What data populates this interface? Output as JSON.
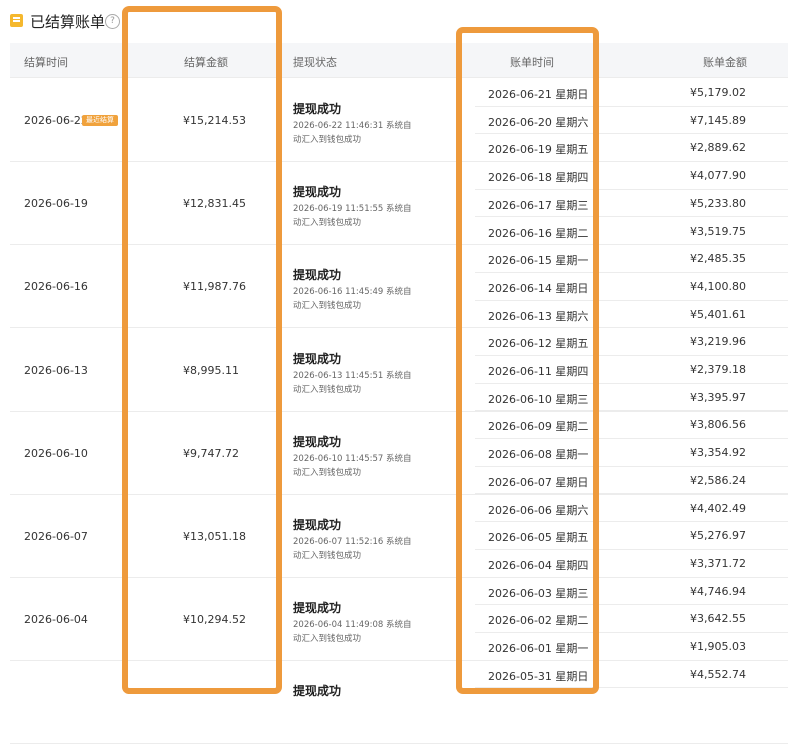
{
  "header": {
    "title": "已结算账单",
    "help_symbol": "?"
  },
  "columns": {
    "settle_time": "结算时间",
    "settle_amount": "结算金额",
    "withdraw_status": "提现状态",
    "bill_time": "账单时间",
    "bill_amount": "账单金额"
  },
  "settlements": [
    {
      "date": "2026-06-22",
      "badge": "最近结算",
      "amount": "¥15,214.53",
      "status": "提现成功",
      "desc": "2026-06-22 11:46:31 系统自动汇入到钱包成功"
    },
    {
      "date": "2026-06-19",
      "badge": "",
      "amount": "¥12,831.45",
      "status": "提现成功",
      "desc": "2026-06-19 11:51:55 系统自动汇入到钱包成功"
    },
    {
      "date": "2026-06-16",
      "badge": "",
      "amount": "¥11,987.76",
      "status": "提现成功",
      "desc": "2026-06-16 11:45:49 系统自动汇入到钱包成功"
    },
    {
      "date": "2026-06-13",
      "badge": "",
      "amount": "¥8,995.11",
      "status": "提现成功",
      "desc": "2026-06-13 11:45:51 系统自动汇入到钱包成功"
    },
    {
      "date": "2026-06-10",
      "badge": "",
      "amount": "¥9,747.72",
      "status": "提现成功",
      "desc": "2026-06-10 11:45:57 系统自动汇入到钱包成功"
    },
    {
      "date": "2026-06-07",
      "badge": "",
      "amount": "¥13,051.18",
      "status": "提现成功",
      "desc": "2026-06-07 11:52:16 系统自动汇入到钱包成功"
    },
    {
      "date": "2026-06-04",
      "badge": "",
      "amount": "¥10,294.52",
      "status": "提现成功",
      "desc": "2026-06-04 11:49:08 系统自动汇入到钱包成功"
    },
    {
      "date": "",
      "badge": "",
      "amount": "",
      "status": "提现成功",
      "desc": ""
    }
  ],
  "bills": [
    {
      "time": "2026-06-21 星期日",
      "amount": "¥5,179.02"
    },
    {
      "time": "2026-06-20 星期六",
      "amount": "¥7,145.89"
    },
    {
      "time": "2026-06-19 星期五",
      "amount": "¥2,889.62"
    },
    {
      "time": "2026-06-18 星期四",
      "amount": "¥4,077.90"
    },
    {
      "time": "2026-06-17 星期三",
      "amount": "¥5,233.80"
    },
    {
      "time": "2026-06-16 星期二",
      "amount": "¥3,519.75"
    },
    {
      "time": "2026-06-15 星期一",
      "amount": "¥2,485.35"
    },
    {
      "time": "2026-06-14 星期日",
      "amount": "¥4,100.80"
    },
    {
      "time": "2026-06-13 星期六",
      "amount": "¥5,401.61"
    },
    {
      "time": "2026-06-12 星期五",
      "amount": "¥3,219.96"
    },
    {
      "time": "2026-06-11 星期四",
      "amount": "¥2,379.18"
    },
    {
      "time": "2026-06-10 星期三",
      "amount": "¥3,395.97"
    },
    {
      "time": "2026-06-09 星期二",
      "amount": "¥3,806.56"
    },
    {
      "time": "2026-06-08 星期一",
      "amount": "¥3,354.92"
    },
    {
      "time": "2026-06-07 星期日",
      "amount": "¥2,586.24"
    },
    {
      "time": "2026-06-06 星期六",
      "amount": "¥4,402.49"
    },
    {
      "time": "2026-06-05 星期五",
      "amount": "¥5,276.97"
    },
    {
      "time": "2026-06-04 星期四",
      "amount": "¥3,371.72"
    },
    {
      "time": "2026-06-03 星期三",
      "amount": "¥4,746.94"
    },
    {
      "time": "2026-06-02 星期二",
      "amount": "¥3,642.55"
    },
    {
      "time": "2026-06-01 星期一",
      "amount": "¥1,905.03"
    },
    {
      "time": "2026-05-31 星期日",
      "amount": "¥4,552.74"
    }
  ],
  "colors": {
    "highlight": "#ee9a3c",
    "badge": "#f0a23c",
    "header_bg": "#f5f6f8"
  }
}
